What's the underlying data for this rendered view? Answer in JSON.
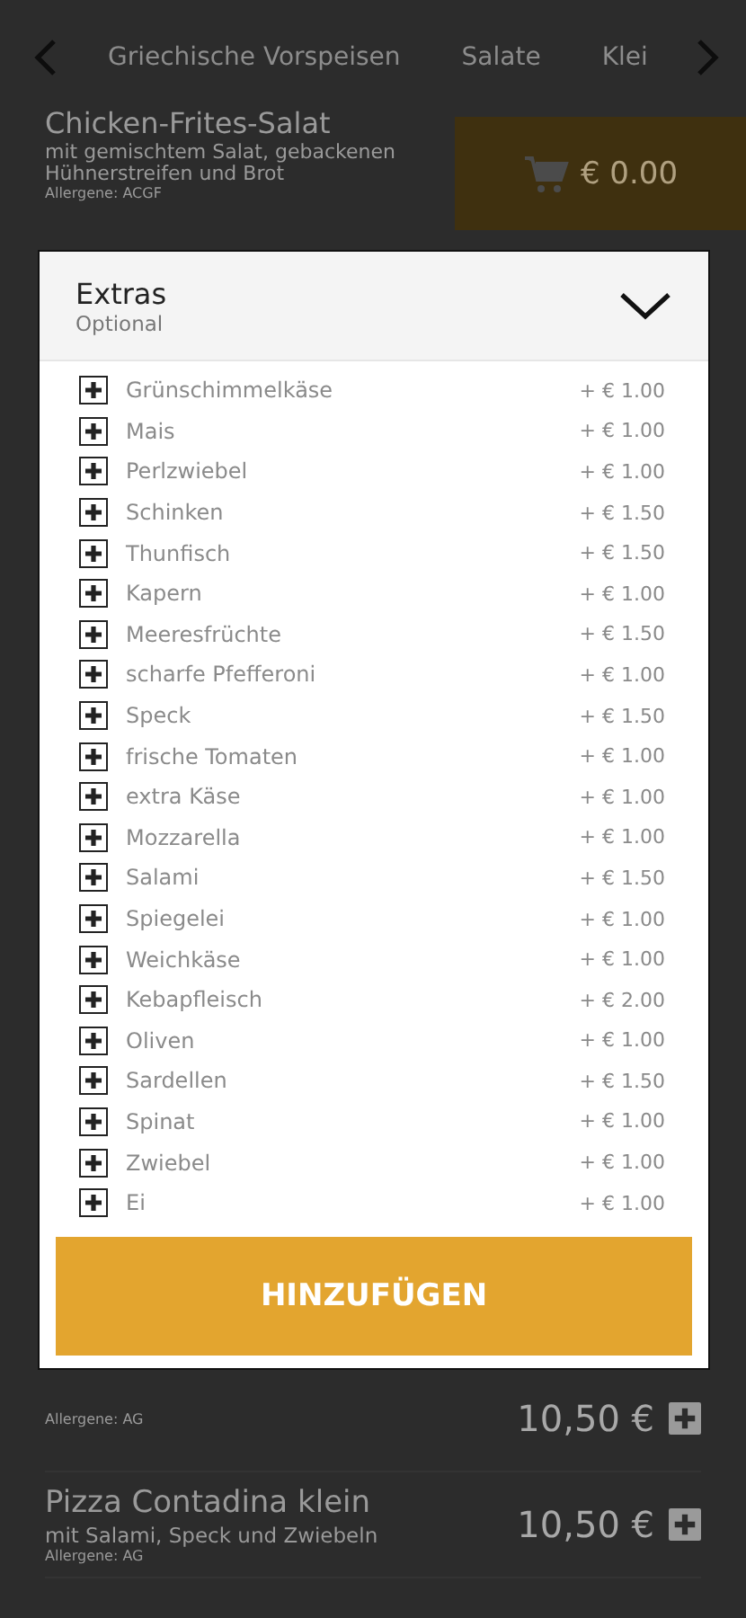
{
  "category_tabs": [
    "Griechische Vorspeisen",
    "Salate",
    "Klei"
  ],
  "current_item": {
    "name": "Chicken-Frites-Salat",
    "description": "mit gemischtem Salat, gebackenen Hühnerstreifen und Brot",
    "allergens": "Allergene: ACGF"
  },
  "cart": {
    "total": "€ 0.00"
  },
  "extras_dialog": {
    "title": "Extras",
    "subtitle": "Optional",
    "options": [
      {
        "name": "Grünschimmelkäse",
        "price": "+ € 1.00"
      },
      {
        "name": "Mais",
        "price": "+ € 1.00"
      },
      {
        "name": "Perlzwiebel",
        "price": "+ € 1.00"
      },
      {
        "name": "Schinken",
        "price": "+ € 1.50"
      },
      {
        "name": "Thunfisch",
        "price": "+ € 1.50"
      },
      {
        "name": "Kapern",
        "price": "+ € 1.00"
      },
      {
        "name": "Meeresfrüchte",
        "price": "+ € 1.50"
      },
      {
        "name": "scharfe Pfefferoni",
        "price": "+ € 1.00"
      },
      {
        "name": "Speck",
        "price": "+ € 1.50"
      },
      {
        "name": "frische Tomaten",
        "price": "+ € 1.00"
      },
      {
        "name": "extra Käse",
        "price": "+ € 1.00"
      },
      {
        "name": "Mozzarella",
        "price": "+ € 1.00"
      },
      {
        "name": "Salami",
        "price": "+ € 1.50"
      },
      {
        "name": "Spiegelei",
        "price": "+ € 1.00"
      },
      {
        "name": "Weichkäse",
        "price": "+ € 1.00"
      },
      {
        "name": "Kebapfleisch",
        "price": "+ € 2.00"
      },
      {
        "name": "Oliven",
        "price": "+ € 1.00"
      },
      {
        "name": "Sardellen",
        "price": "+ € 1.50"
      },
      {
        "name": "Spinat",
        "price": "+ € 1.00"
      },
      {
        "name": "Zwiebel",
        "price": "+ € 1.00"
      },
      {
        "name": "Ei",
        "price": "+ € 1.00"
      }
    ],
    "add_button": "HINZUFÜGEN"
  },
  "menu_items": [
    {
      "allergens": "Allergene: AG",
      "price": "10,50 €"
    },
    {
      "name": "Pizza Contadina klein",
      "description": "mit Salami, Speck und Zwiebeln",
      "allergens": "Allergene: AG",
      "price": "10,50 €"
    }
  ]
}
